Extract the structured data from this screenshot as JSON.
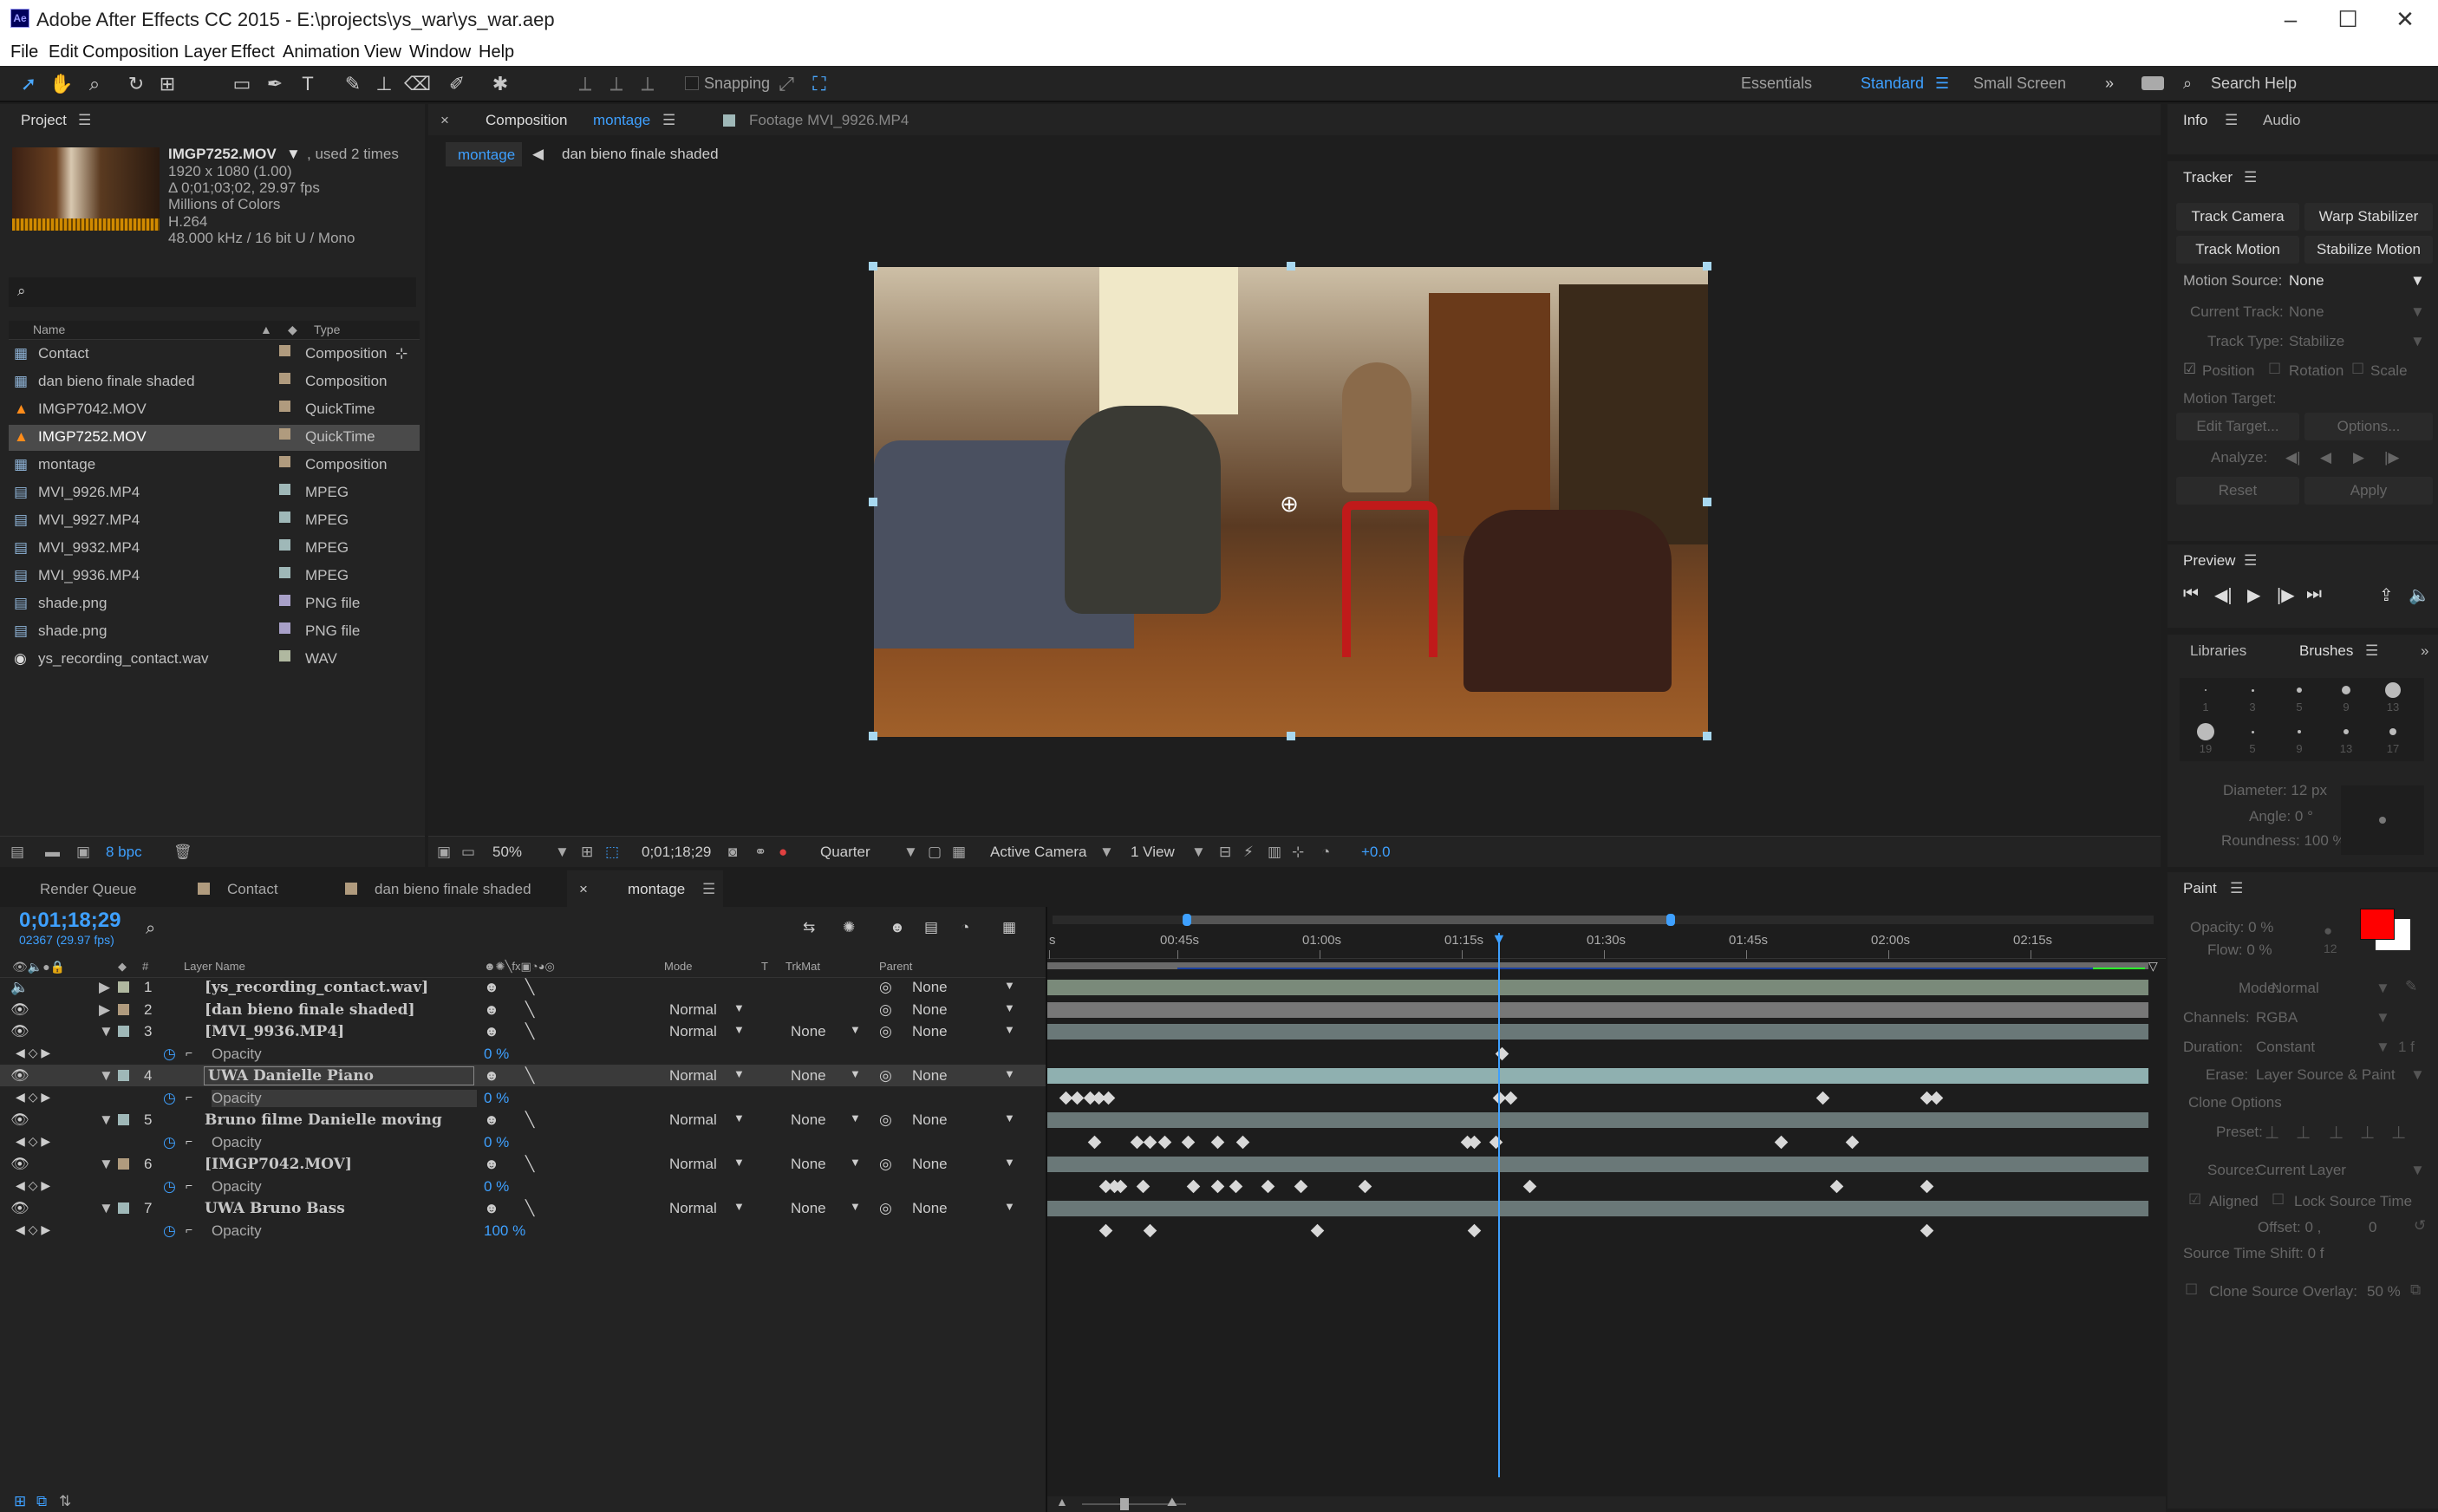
{
  "app": {
    "title": "Adobe After Effects CC 2015 - E:\\projects\\ys_war\\ys_war.aep",
    "icon_label": "Ae"
  },
  "menu": [
    "File",
    "Edit",
    "Composition",
    "Layer",
    "Effect",
    "Animation",
    "View",
    "Window",
    "Help"
  ],
  "toolbar": {
    "snapping": "Snapping",
    "workspaces": [
      "Essentials",
      "Standard",
      "Small Screen"
    ],
    "search_help": "Search Help",
    "active_workspace": "Standard"
  },
  "project": {
    "title": "Project",
    "footage": {
      "name": "IMGP7252.MOV",
      "used": ", used 2 times",
      "res": "1920 x 1080 (1.00)",
      "dur": "Δ 0;01;03;02, 29.97 fps",
      "colors": "Millions of Colors",
      "codec": "H.264",
      "audio": "48.000 kHz / 16 bit U / Mono"
    },
    "col_name": "Name",
    "col_type": "Type",
    "items": [
      {
        "name": "Contact",
        "type": "Composition",
        "color": "#b09b7e",
        "icon": "comp"
      },
      {
        "name": "dan bieno finale shaded",
        "type": "Composition",
        "color": "#b09b7e",
        "icon": "comp"
      },
      {
        "name": "IMGP7042.MOV",
        "type": "QuickTime",
        "color": "#b09b7e",
        "icon": "cone"
      },
      {
        "name": "IMGP7252.MOV",
        "type": "QuickTime",
        "color": "#b09b7e",
        "icon": "cone",
        "selected": true
      },
      {
        "name": "montage",
        "type": "Composition",
        "color": "#b09b7e",
        "icon": "comp"
      },
      {
        "name": "MVI_9926.MP4",
        "type": "MPEG",
        "color": "#9fb8b8",
        "icon": "file"
      },
      {
        "name": "MVI_9927.MP4",
        "type": "MPEG",
        "color": "#9fb8b8",
        "icon": "file"
      },
      {
        "name": "MVI_9932.MP4",
        "type": "MPEG",
        "color": "#9fb8b8",
        "icon": "file"
      },
      {
        "name": "MVI_9936.MP4",
        "type": "MPEG",
        "color": "#9fb8b8",
        "icon": "file"
      },
      {
        "name": "shade.png",
        "type": "PNG file",
        "color": "#a8a0c8",
        "icon": "file"
      },
      {
        "name": "shade.png",
        "type": "PNG file",
        "color": "#a8a0c8",
        "icon": "file"
      },
      {
        "name": "ys_recording_contact.wav",
        "type": "WAV",
        "color": "#b0b8a0",
        "icon": "audio"
      }
    ],
    "bpc": "8 bpc"
  },
  "comp_viewer": {
    "tab_comp_prefix": "Composition",
    "tab_comp_name": "montage",
    "tab_footage": "Footage MVI_9926.MP4",
    "crumb_active": "montage",
    "crumb_next": "dan bieno finale shaded",
    "zoom": "50%",
    "timecode": "0;01;18;29",
    "resolution": "Quarter",
    "camera": "Active Camera",
    "views": "1 View",
    "exposure": "+0.0"
  },
  "info": {
    "tab_info": "Info",
    "tab_audio": "Audio"
  },
  "tracker": {
    "title": "Tracker",
    "track_camera": "Track Camera",
    "warp_stabilizer": "Warp Stabilizer",
    "track_motion": "Track Motion",
    "stabilize_motion": "Stabilize Motion",
    "motion_source_label": "Motion Source:",
    "motion_source": "None",
    "current_track_label": "Current Track:",
    "current_track": "None",
    "track_type_label": "Track Type:",
    "track_type": "Stabilize",
    "position": "Position",
    "rotation": "Rotation",
    "scale": "Scale",
    "motion_target": "Motion Target:",
    "edit_target": "Edit Target...",
    "options": "Options...",
    "analyze": "Analyze:",
    "reset": "Reset",
    "apply": "Apply"
  },
  "preview": {
    "title": "Preview"
  },
  "brushes": {
    "tab_libraries": "Libraries",
    "tab_brushes": "Brushes",
    "sizes_row1": [
      "1",
      "3",
      "5",
      "9",
      "13"
    ],
    "sizes_row2": [
      "19",
      "5",
      "9",
      "13",
      "17"
    ],
    "diameter": "Diameter: 12 px",
    "angle": "Angle: 0 °",
    "roundness": "Roundness: 100 %"
  },
  "paint": {
    "title": "Paint",
    "opacity": "Opacity: 0 %",
    "flow": "Flow: 0 %",
    "flow_val": "12",
    "mode_label": "Mode:",
    "mode": "Normal",
    "channels_label": "Channels:",
    "channels": "RGBA",
    "duration_label": "Duration:",
    "duration": "Constant",
    "duration_val": "1 f",
    "erase_label": "Erase:",
    "erase": "Layer Source & Paint",
    "clone_options": "Clone Options",
    "preset": "Preset:",
    "source_label": "Source:",
    "source": "Current Layer",
    "aligned": "Aligned",
    "lock_source": "Lock Source Time",
    "offset": "Offset: 0 ,",
    "offset2": "0",
    "shift": "Source Time Shift: 0 f",
    "overlay": "Clone Source Overlay:",
    "overlay_val": "50 %",
    "fg_color": "#ff0000",
    "bg_color": "#ffffff"
  },
  "timeline": {
    "tabs": [
      "Render Queue",
      "Contact",
      "dan bieno finale shaded",
      "montage"
    ],
    "timecode": "0;01;18;29",
    "frames": "02367 (29.97 fps)",
    "col_num": "#",
    "col_layer": "Layer Name",
    "col_mode": "Mode",
    "col_t": "T",
    "col_trkmat": "TrkMat",
    "col_parent": "Parent",
    "ruler": [
      "s",
      "00:45s",
      "01:00s",
      "01:15s",
      "01:30s",
      "01:45s",
      "02:00s",
      "02:15s"
    ],
    "layers": [
      {
        "num": "1",
        "name": "[ys_recording_contact.wav]",
        "mode": "",
        "trkmat": "",
        "parent": "None",
        "color": "#b0b8a0",
        "opacity": null,
        "keys": []
      },
      {
        "num": "2",
        "name": "[dan bieno finale shaded]",
        "mode": "Normal",
        "trkmat": "",
        "parent": "None",
        "color": "#b09b7e",
        "opacity": null,
        "keys": []
      },
      {
        "num": "3",
        "name": "[MVI_9936.MP4]",
        "mode": "Normal",
        "trkmat": "None",
        "parent": "None",
        "color": "#9fb8b8",
        "opacity": "0 %",
        "keys": [
          84.4
        ]
      },
      {
        "num": "4",
        "name": "UWA Danielle Piano",
        "mode": "Normal",
        "trkmat": "None",
        "parent": "None",
        "color": "#9fb8b8",
        "opacity": "0 %",
        "keys": [
          23.2,
          24.8,
          26.6,
          27.8,
          29.1,
          84.0,
          85.6,
          129.4,
          144.0,
          145.3
        ],
        "selected": true
      },
      {
        "num": "5",
        "name": "Bruno filme Danielle moving",
        "mode": "Normal",
        "trkmat": "None",
        "parent": "None",
        "color": "#9fb8b8",
        "opacity": "0 %",
        "keys": [
          27.2,
          33.2,
          35.0,
          37.1,
          40.3,
          44.5,
          48.0,
          79.5,
          80.5,
          83.5,
          123.5,
          133.5
        ]
      },
      {
        "num": "6",
        "name": "[IMGP7042.MOV]",
        "mode": "Normal",
        "trkmat": "None",
        "parent": "None",
        "color": "#b09b7e",
        "opacity": "0 %",
        "keys": [
          28.8,
          30.0,
          30.8,
          34.0,
          41.0,
          44.5,
          47.0,
          51.5,
          56.2,
          65.2,
          88.2,
          131.3,
          144.0
        ]
      },
      {
        "num": "7",
        "name": "UWA Bruno Bass",
        "mode": "Normal",
        "trkmat": "None",
        "parent": "None",
        "color": "#9fb8b8",
        "opacity": "100 %",
        "keys": [
          28.8,
          35.0,
          58.5,
          80.5,
          144.0
        ]
      }
    ],
    "opacity_label": "Opacity"
  }
}
